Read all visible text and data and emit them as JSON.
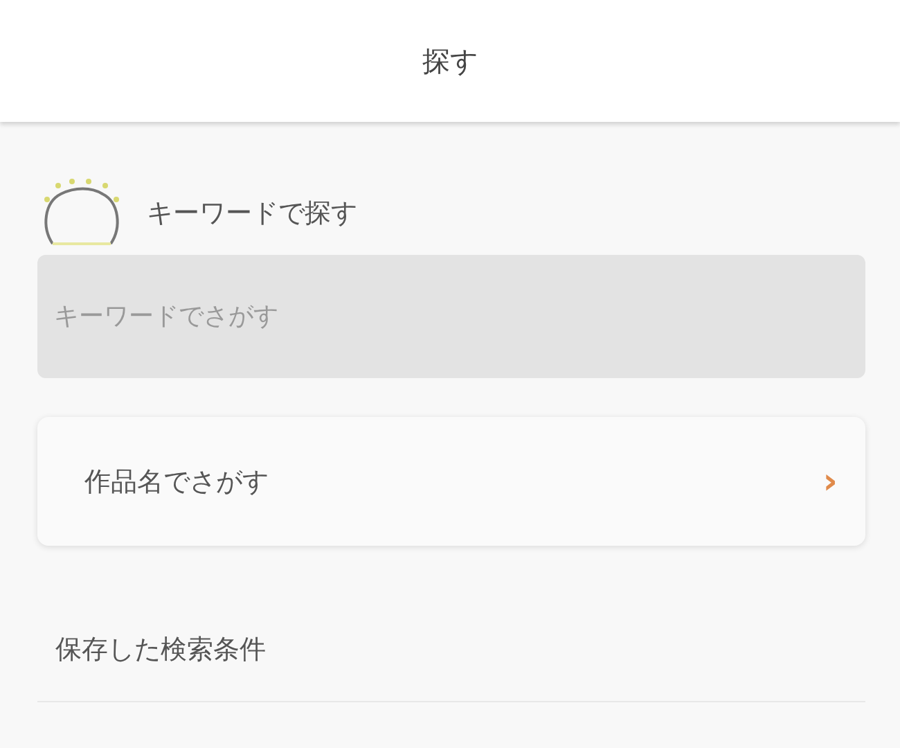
{
  "header": {
    "title": "探す"
  },
  "keyword_section": {
    "label": "キーワードで探す",
    "search": {
      "placeholder": "キーワードでさがす"
    }
  },
  "title_search": {
    "label": "作品名でさがす",
    "arrow": "›"
  },
  "saved_conditions": {
    "heading": "保存した検索条件"
  }
}
